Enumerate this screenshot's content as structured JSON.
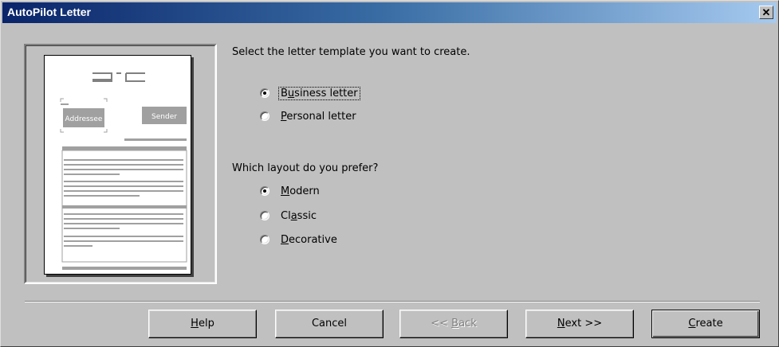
{
  "window": {
    "title": "AutoPilot Letter",
    "close_label": "✕"
  },
  "preview": {
    "addressee_label": "Addressee",
    "sender_label": "Sender"
  },
  "template_question": "Select the letter template you want to create.",
  "template_options": [
    {
      "pre": "B",
      "hot": "u",
      "post": "siness letter",
      "checked": true
    },
    {
      "pre": "",
      "hot": "P",
      "post": "ersonal letter",
      "checked": false
    }
  ],
  "layout_question": "Which layout do you prefer?",
  "layout_options": [
    {
      "pre": "",
      "hot": "M",
      "post": "odern",
      "checked": true
    },
    {
      "pre": "Cl",
      "hot": "a",
      "post": "ssic",
      "checked": false
    },
    {
      "pre": "",
      "hot": "D",
      "post": "ecorative",
      "checked": false
    }
  ],
  "buttons": {
    "help": {
      "pre": "",
      "hot": "H",
      "post": "elp"
    },
    "cancel": {
      "label": "Cancel"
    },
    "back": {
      "pre": "<< ",
      "hot": "B",
      "post": "ack"
    },
    "next": {
      "pre": "",
      "hot": "N",
      "post": "ext >>"
    },
    "create": {
      "pre": "",
      "hot": "C",
      "post": "reate"
    }
  }
}
